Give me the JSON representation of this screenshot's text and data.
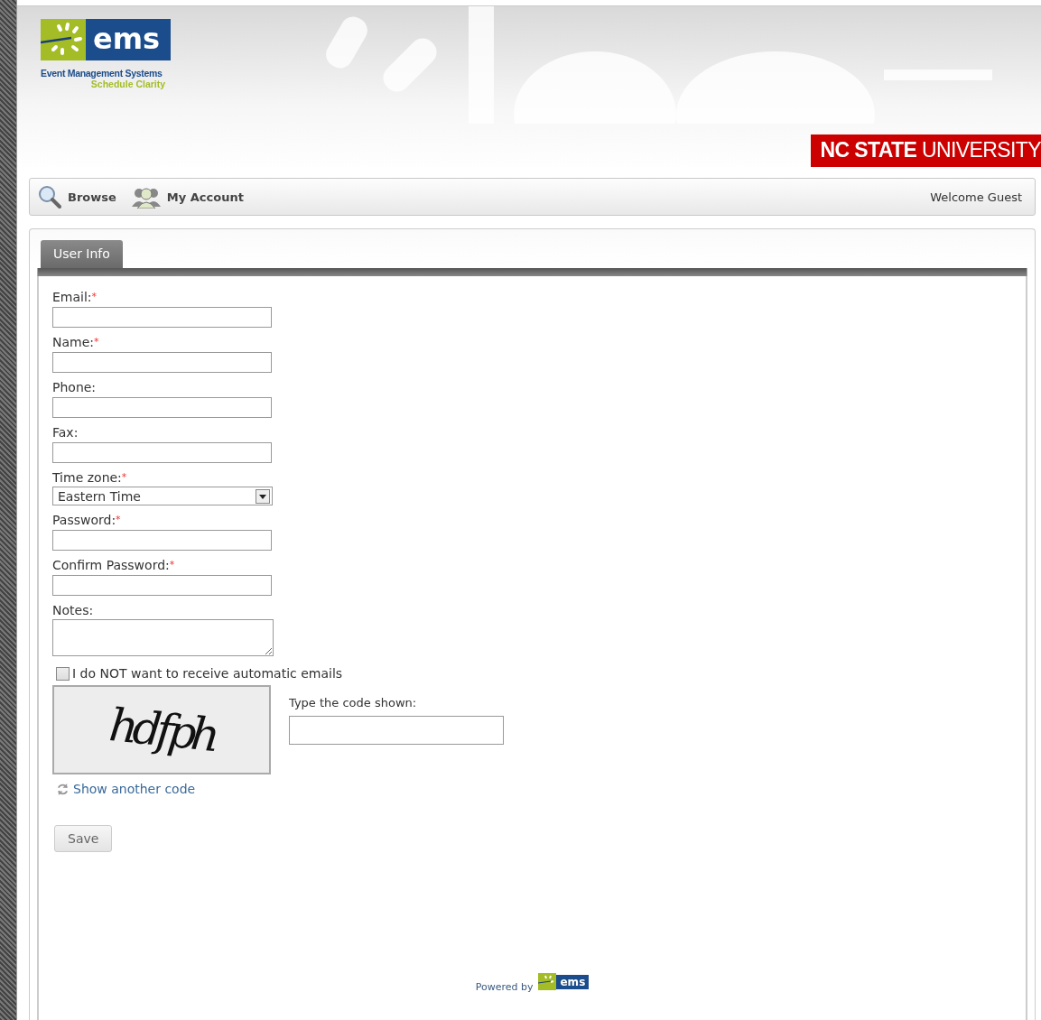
{
  "header": {
    "logo": {
      "mark": "ems",
      "name": "Event Management Systems",
      "tagline": "Schedule Clarity"
    },
    "university": {
      "bold": "NC STATE",
      "light": "UNIVERSITY"
    }
  },
  "nav": {
    "items": [
      {
        "label": "Browse",
        "kind": "search"
      },
      {
        "label": "My Account",
        "kind": "account"
      }
    ],
    "welcome": "Welcome Guest"
  },
  "tabs": [
    {
      "label": "User Info",
      "selected": true
    }
  ],
  "form": {
    "required_mark": "*",
    "fields": [
      {
        "label": "Email:",
        "kind": "text",
        "required": true
      },
      {
        "label": "Name:",
        "kind": "text",
        "required": true
      },
      {
        "label": "Phone:",
        "kind": "text",
        "required": false
      },
      {
        "label": "Fax:",
        "kind": "text",
        "required": false
      },
      {
        "label": "Time zone:",
        "kind": "select",
        "required": true,
        "value": "Eastern Time"
      },
      {
        "label": "Password:",
        "kind": "text",
        "required": true
      },
      {
        "label": "Confirm Password:",
        "kind": "text",
        "required": true
      },
      {
        "label": "Notes:",
        "kind": "textarea",
        "required": false
      }
    ],
    "opt_out": {
      "label": "I do NOT want to receive automatic emails",
      "checked": false
    },
    "captcha": {
      "code": "hdfph",
      "prompt": "Type the code shown:",
      "refresh": "Show another code"
    },
    "save": "Save"
  },
  "footer": {
    "powered_by": "Powered by",
    "logo": "ems"
  }
}
